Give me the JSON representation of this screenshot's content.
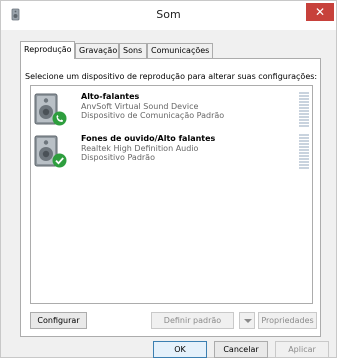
{
  "window": {
    "title": "Som",
    "close_glyph": "✕"
  },
  "tabs": [
    {
      "label": "Reprodução",
      "active": true
    },
    {
      "label": "Gravação",
      "active": false
    },
    {
      "label": "Sons",
      "active": false
    },
    {
      "label": "Comunicações",
      "active": false
    }
  ],
  "panel": {
    "instruction": "Selecione um dispositivo de reprodução para alterar suas configurações:"
  },
  "devices": [
    {
      "name": "Alto-falantes",
      "line1": "AnvSoft Virtual Sound Device",
      "line2": "Dispositivo de Comunicação Padrão",
      "status_icon": "phone-icon",
      "status_color": "#2e9e3e"
    },
    {
      "name": "Fones de ouvido/Alto falantes",
      "line1": "Realtek High Definition Audio",
      "line2": "Dispositivo Padrão",
      "status_icon": "checkmark-icon",
      "status_color": "#2e9e3e"
    }
  ],
  "buttons": {
    "configure": "Configurar",
    "set_default": "Definir padrão",
    "properties": "Propriedades",
    "ok": "OK",
    "cancel": "Cancelar",
    "apply": "Aplicar"
  },
  "colors": {
    "close_button": "#c7413b",
    "level_meter": "#c9d3de"
  }
}
